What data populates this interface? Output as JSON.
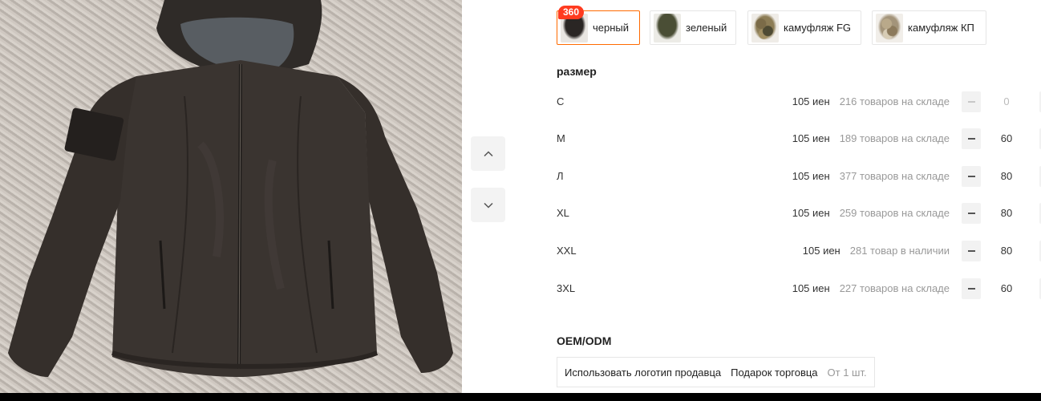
{
  "colors": [
    {
      "label": "черный",
      "thumb": "black-jacket-thumb",
      "selected": true,
      "badge": "360"
    },
    {
      "label": "зеленый",
      "thumb": "green-jacket-thumb",
      "selected": false
    },
    {
      "label": "камуфляж FG",
      "thumb": "camo-fg-jacket-thumb",
      "selected": false
    },
    {
      "label": "камуфляж КП",
      "thumb": "camo-kp-jacket-thumb",
      "selected": false
    }
  ],
  "size_section": {
    "title": "размер",
    "rows": [
      {
        "size": "С",
        "price": "105 иен",
        "stock": "216 товаров на складе",
        "qty": "0"
      },
      {
        "size": "M",
        "price": "105 иен",
        "stock": "189 товаров на складе",
        "qty": "60"
      },
      {
        "size": "Л",
        "price": "105 иен",
        "stock": "377 товаров на складе",
        "qty": "80"
      },
      {
        "size": "XL",
        "price": "105 иен",
        "stock": "259 товаров на складе",
        "qty": "80"
      },
      {
        "size": "XXL",
        "price": "105 иен",
        "stock": "281 товар в наличии",
        "qty": "80"
      },
      {
        "size": "3XL",
        "price": "105 иен",
        "stock": "227 товаров на складе",
        "qty": "60"
      }
    ]
  },
  "oem": {
    "title": "OEM/ODM",
    "option_logo": "Использовать логотип продавца",
    "option_gift": "Подарок торговца",
    "min_order": "От 1 шт."
  },
  "icons": {
    "nav_up": "chevron-up-icon",
    "nav_down": "chevron-down-icon",
    "minus": "minus-icon"
  },
  "colors_theme": {
    "accent": "#ff6a00",
    "badge": "#ff3b1f",
    "muted_text": "#999999"
  }
}
